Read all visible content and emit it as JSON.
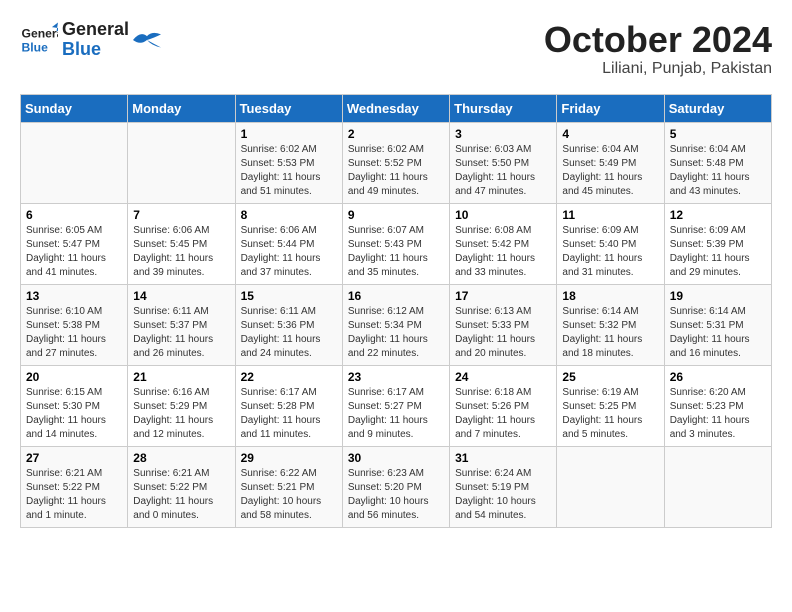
{
  "logo": {
    "line1": "General",
    "line2": "Blue"
  },
  "title": "October 2024",
  "location": "Liliani, Punjab, Pakistan",
  "days_of_week": [
    "Sunday",
    "Monday",
    "Tuesday",
    "Wednesday",
    "Thursday",
    "Friday",
    "Saturday"
  ],
  "weeks": [
    [
      {
        "day": "",
        "info": ""
      },
      {
        "day": "",
        "info": ""
      },
      {
        "day": "1",
        "info": "Sunrise: 6:02 AM\nSunset: 5:53 PM\nDaylight: 11 hours and 51 minutes."
      },
      {
        "day": "2",
        "info": "Sunrise: 6:02 AM\nSunset: 5:52 PM\nDaylight: 11 hours and 49 minutes."
      },
      {
        "day": "3",
        "info": "Sunrise: 6:03 AM\nSunset: 5:50 PM\nDaylight: 11 hours and 47 minutes."
      },
      {
        "day": "4",
        "info": "Sunrise: 6:04 AM\nSunset: 5:49 PM\nDaylight: 11 hours and 45 minutes."
      },
      {
        "day": "5",
        "info": "Sunrise: 6:04 AM\nSunset: 5:48 PM\nDaylight: 11 hours and 43 minutes."
      }
    ],
    [
      {
        "day": "6",
        "info": "Sunrise: 6:05 AM\nSunset: 5:47 PM\nDaylight: 11 hours and 41 minutes."
      },
      {
        "day": "7",
        "info": "Sunrise: 6:06 AM\nSunset: 5:45 PM\nDaylight: 11 hours and 39 minutes."
      },
      {
        "day": "8",
        "info": "Sunrise: 6:06 AM\nSunset: 5:44 PM\nDaylight: 11 hours and 37 minutes."
      },
      {
        "day": "9",
        "info": "Sunrise: 6:07 AM\nSunset: 5:43 PM\nDaylight: 11 hours and 35 minutes."
      },
      {
        "day": "10",
        "info": "Sunrise: 6:08 AM\nSunset: 5:42 PM\nDaylight: 11 hours and 33 minutes."
      },
      {
        "day": "11",
        "info": "Sunrise: 6:09 AM\nSunset: 5:40 PM\nDaylight: 11 hours and 31 minutes."
      },
      {
        "day": "12",
        "info": "Sunrise: 6:09 AM\nSunset: 5:39 PM\nDaylight: 11 hours and 29 minutes."
      }
    ],
    [
      {
        "day": "13",
        "info": "Sunrise: 6:10 AM\nSunset: 5:38 PM\nDaylight: 11 hours and 27 minutes."
      },
      {
        "day": "14",
        "info": "Sunrise: 6:11 AM\nSunset: 5:37 PM\nDaylight: 11 hours and 26 minutes."
      },
      {
        "day": "15",
        "info": "Sunrise: 6:11 AM\nSunset: 5:36 PM\nDaylight: 11 hours and 24 minutes."
      },
      {
        "day": "16",
        "info": "Sunrise: 6:12 AM\nSunset: 5:34 PM\nDaylight: 11 hours and 22 minutes."
      },
      {
        "day": "17",
        "info": "Sunrise: 6:13 AM\nSunset: 5:33 PM\nDaylight: 11 hours and 20 minutes."
      },
      {
        "day": "18",
        "info": "Sunrise: 6:14 AM\nSunset: 5:32 PM\nDaylight: 11 hours and 18 minutes."
      },
      {
        "day": "19",
        "info": "Sunrise: 6:14 AM\nSunset: 5:31 PM\nDaylight: 11 hours and 16 minutes."
      }
    ],
    [
      {
        "day": "20",
        "info": "Sunrise: 6:15 AM\nSunset: 5:30 PM\nDaylight: 11 hours and 14 minutes."
      },
      {
        "day": "21",
        "info": "Sunrise: 6:16 AM\nSunset: 5:29 PM\nDaylight: 11 hours and 12 minutes."
      },
      {
        "day": "22",
        "info": "Sunrise: 6:17 AM\nSunset: 5:28 PM\nDaylight: 11 hours and 11 minutes."
      },
      {
        "day": "23",
        "info": "Sunrise: 6:17 AM\nSunset: 5:27 PM\nDaylight: 11 hours and 9 minutes."
      },
      {
        "day": "24",
        "info": "Sunrise: 6:18 AM\nSunset: 5:26 PM\nDaylight: 11 hours and 7 minutes."
      },
      {
        "day": "25",
        "info": "Sunrise: 6:19 AM\nSunset: 5:25 PM\nDaylight: 11 hours and 5 minutes."
      },
      {
        "day": "26",
        "info": "Sunrise: 6:20 AM\nSunset: 5:23 PM\nDaylight: 11 hours and 3 minutes."
      }
    ],
    [
      {
        "day": "27",
        "info": "Sunrise: 6:21 AM\nSunset: 5:22 PM\nDaylight: 11 hours and 1 minute."
      },
      {
        "day": "28",
        "info": "Sunrise: 6:21 AM\nSunset: 5:22 PM\nDaylight: 11 hours and 0 minutes."
      },
      {
        "day": "29",
        "info": "Sunrise: 6:22 AM\nSunset: 5:21 PM\nDaylight: 10 hours and 58 minutes."
      },
      {
        "day": "30",
        "info": "Sunrise: 6:23 AM\nSunset: 5:20 PM\nDaylight: 10 hours and 56 minutes."
      },
      {
        "day": "31",
        "info": "Sunrise: 6:24 AM\nSunset: 5:19 PM\nDaylight: 10 hours and 54 minutes."
      },
      {
        "day": "",
        "info": ""
      },
      {
        "day": "",
        "info": ""
      }
    ]
  ]
}
